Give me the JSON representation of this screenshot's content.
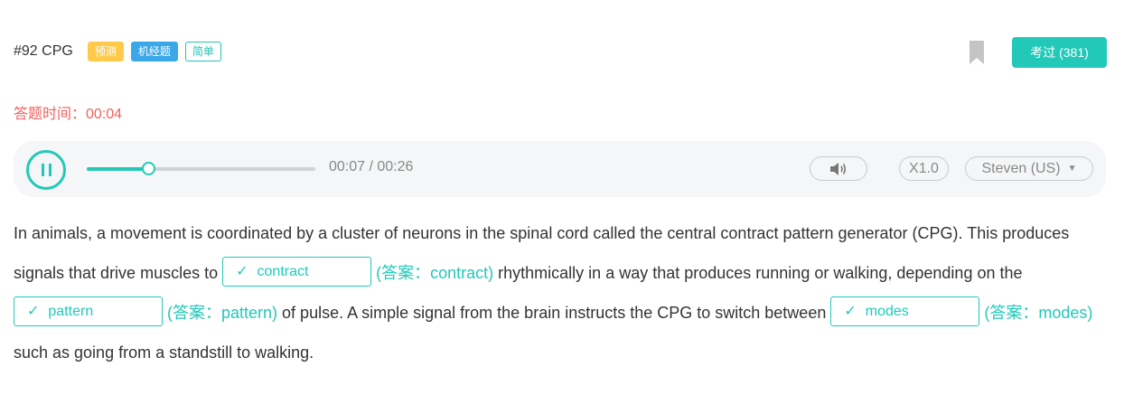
{
  "header": {
    "question_id": "#92 CPG",
    "tags": {
      "predict": "预测",
      "machine": "机经题",
      "easy": "简单"
    },
    "exam_button": "考过 (381)"
  },
  "timer": {
    "label": "答题时间：",
    "value": "00:04"
  },
  "player": {
    "time_display": "00:07 / 00:26",
    "progress": 0.27,
    "speed": "X1.0",
    "voice": "Steven (US)"
  },
  "passage": {
    "text1": "In animals, a movement is coordinated by a cluster of neurons in the spinal cord called the central contract pattern generator (CPG). This produces signals that drive muscles to ",
    "blank1": "contract",
    "answer1": "(答案：contract)",
    "text2": " rhythmically in a way that produces running or walking, depending on the ",
    "blank2": "pattern",
    "answer2": "(答案：pattern)",
    "text3": " of pulse. A simple signal from the brain instructs the CPG to switch between ",
    "blank3": "modes",
    "answer3": "(答案：modes)",
    "text4": " such as going from a standstill to walking."
  },
  "colors": {
    "accent": "#22c9b8",
    "timer": "#f0625d",
    "tag_predict": "#ffc94a",
    "tag_machine": "#3aa7e8"
  },
  "icons": {
    "bookmark": "bookmark-icon",
    "pause": "pause-icon",
    "volume": "volume-icon",
    "check": "check-icon",
    "dropdown": "caret-down-icon"
  }
}
